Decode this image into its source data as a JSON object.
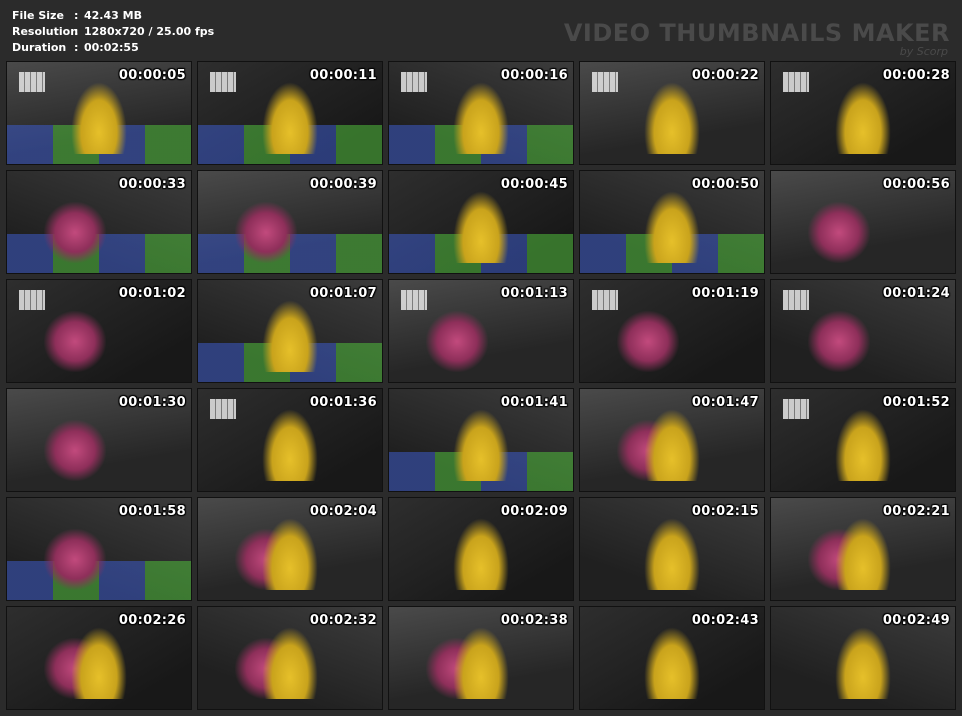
{
  "info": {
    "file_size_label": "File Size",
    "file_size_value": "42.43 MB",
    "resolution_label": "Resolution",
    "resolution_value": "1280x720 / 25.00 fps",
    "duration_label": "Duration",
    "duration_value": "00:02:55",
    "separator": ":"
  },
  "watermark": {
    "title": "VIDEO THUMBNAILS MAKER",
    "subtitle": "by Scorp"
  },
  "thumbnails": [
    {
      "time": "00:00:05",
      "scene": "window-mat-yellow"
    },
    {
      "time": "00:00:11",
      "scene": "window-mat-yellow"
    },
    {
      "time": "00:00:16",
      "scene": "window-mat-yellow"
    },
    {
      "time": "00:00:22",
      "scene": "window-yellow"
    },
    {
      "time": "00:00:28",
      "scene": "window-yellow"
    },
    {
      "time": "00:00:33",
      "scene": "mat-pink"
    },
    {
      "time": "00:00:39",
      "scene": "mat-pink"
    },
    {
      "time": "00:00:45",
      "scene": "mat-yellow"
    },
    {
      "time": "00:00:50",
      "scene": "mat-yellow"
    },
    {
      "time": "00:00:56",
      "scene": "pink"
    },
    {
      "time": "00:01:02",
      "scene": "window-pink"
    },
    {
      "time": "00:01:07",
      "scene": "mat-yellow"
    },
    {
      "time": "00:01:13",
      "scene": "window-pink"
    },
    {
      "time": "00:01:19",
      "scene": "window-pink"
    },
    {
      "time": "00:01:24",
      "scene": "window-pink"
    },
    {
      "time": "00:01:30",
      "scene": "pink"
    },
    {
      "time": "00:01:36",
      "scene": "window-yellow"
    },
    {
      "time": "00:01:41",
      "scene": "mat-yellow"
    },
    {
      "time": "00:01:47",
      "scene": "yellow-pink"
    },
    {
      "time": "00:01:52",
      "scene": "window-yellow"
    },
    {
      "time": "00:01:58",
      "scene": "mat-pink"
    },
    {
      "time": "00:02:04",
      "scene": "yellow-pink"
    },
    {
      "time": "00:02:09",
      "scene": "yellow"
    },
    {
      "time": "00:02:15",
      "scene": "yellow"
    },
    {
      "time": "00:02:21",
      "scene": "yellow-pink"
    },
    {
      "time": "00:02:26",
      "scene": "yellow-pink"
    },
    {
      "time": "00:02:32",
      "scene": "yellow-pink"
    },
    {
      "time": "00:02:38",
      "scene": "yellow-pink"
    },
    {
      "time": "00:02:43",
      "scene": "yellow"
    },
    {
      "time": "00:02:49",
      "scene": "yellow"
    }
  ]
}
